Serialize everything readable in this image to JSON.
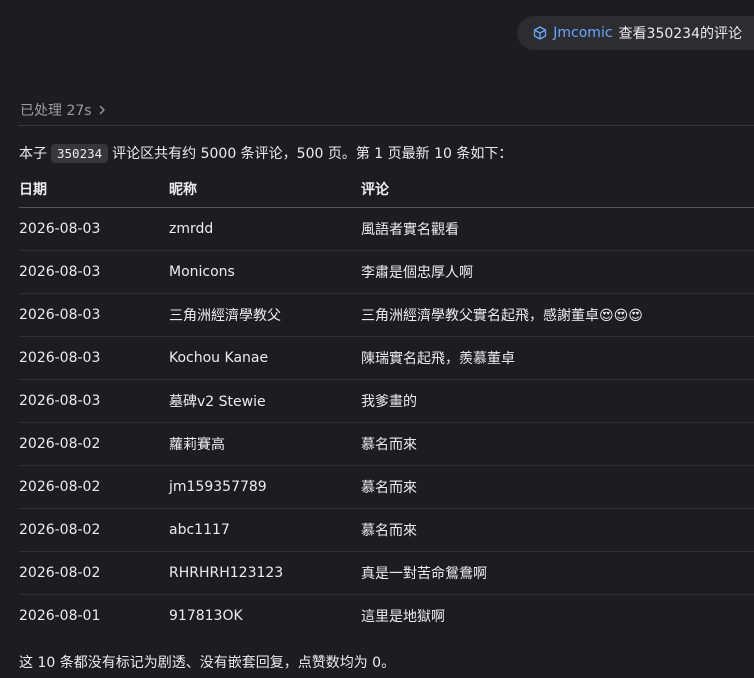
{
  "user_message": {
    "icon": "cube-icon",
    "tool_name": "Jmcomic",
    "text": "查看350234的评论"
  },
  "processed": {
    "label": "已处理 27s",
    "icon": "chevron-right-icon"
  },
  "intro": {
    "prefix": "本子",
    "album_id": "350234",
    "suffix": "评论区共有约 5000 条评论，500 页。第 1 页最新 10 条如下："
  },
  "table": {
    "headers": [
      "日期",
      "昵称",
      "评论"
    ],
    "rows": [
      {
        "date": "2026-08-03",
        "nickname": "zmrdd",
        "comment": "風語者實名觀看"
      },
      {
        "date": "2026-08-03",
        "nickname": "Monicons",
        "comment": "李肅是個忠厚人啊"
      },
      {
        "date": "2026-08-03",
        "nickname": "三角洲經濟學教父",
        "comment": "三角洲經濟學教父實名起飛，感謝董卓😍😍😍"
      },
      {
        "date": "2026-08-03",
        "nickname": "Kochou Kanae",
        "comment": "陳瑞實名起飛，羨慕董卓"
      },
      {
        "date": "2026-08-03",
        "nickname": "墓碑v2 Stewie",
        "comment": "我爹畫的"
      },
      {
        "date": "2026-08-02",
        "nickname": "蘿莉賽高",
        "comment": "慕名而來"
      },
      {
        "date": "2026-08-02",
        "nickname": "jm159357789",
        "comment": "慕名而來"
      },
      {
        "date": "2026-08-02",
        "nickname": "abc1117",
        "comment": "慕名而來"
      },
      {
        "date": "2026-08-02",
        "nickname": "RHRHRH123123",
        "comment": "真是一對苦命鴛鴦啊"
      },
      {
        "date": "2026-08-01",
        "nickname": "917813OK",
        "comment": "這里是地獄啊"
      }
    ]
  },
  "footer_note": "这 10 条都没有标记为剧透、没有嵌套回复，点赞数均为 0。",
  "colors": {
    "background": "#1d1d20",
    "accent": "#6aa7ff",
    "bubble": "#2c2c31",
    "muted_text": "#9b9ba1"
  }
}
